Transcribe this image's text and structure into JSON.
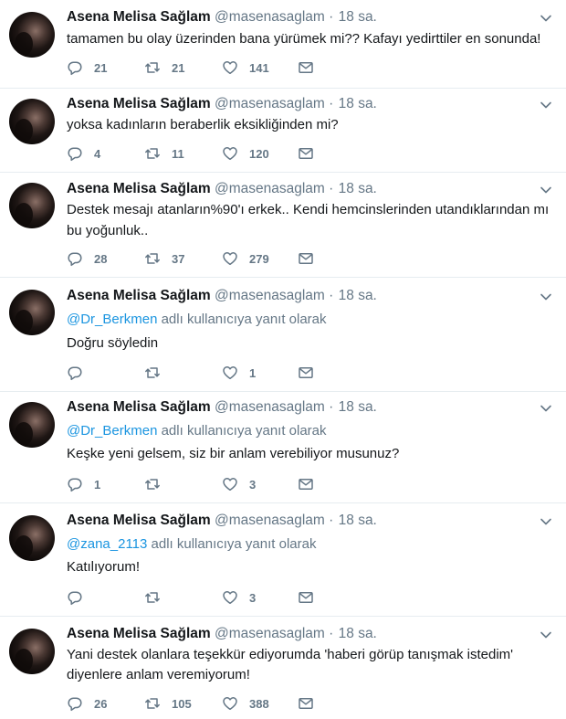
{
  "tweets": [
    {
      "name": "Asena Melisa Sağlam",
      "handle": "@masenasaglam",
      "dot": "·",
      "time": "18 sa.",
      "reply_to": null,
      "lines": [
        "tamamen bu olay üzerinden bana yürümek mi?? Kafayı yedirttiler en sonunda!"
      ],
      "replies": "21",
      "retweets": "21",
      "likes": "141"
    },
    {
      "name": "Asena Melisa Sağlam",
      "handle": "@masenasaglam",
      "dot": "·",
      "time": "18 sa.",
      "reply_to": null,
      "lines": [
        "yoksa kadınların beraberlik eksikliğinden mi?"
      ],
      "replies": "4",
      "retweets": "11",
      "likes": "120"
    },
    {
      "name": "Asena Melisa Sağlam",
      "handle": "@masenasaglam",
      "dot": "·",
      "time": "18 sa.",
      "reply_to": null,
      "lines": [
        "Destek mesajı atanların%90'ı erkek.. Kendi hemcinslerinden utandıklarından mı",
        "bu yoğunluk.."
      ],
      "replies": "28",
      "retweets": "37",
      "likes": "279"
    },
    {
      "name": "Asena Melisa Sağlam",
      "handle": "@masenasaglam",
      "dot": "·",
      "time": "18 sa.",
      "reply_to": {
        "mention": "@Dr_Berkmen",
        "suffix": " adlı kullanıcıya yanıt olarak"
      },
      "lines": [
        "Doğru söyledin"
      ],
      "replies": "",
      "retweets": "",
      "likes": "1"
    },
    {
      "name": "Asena Melisa Sağlam",
      "handle": "@masenasaglam",
      "dot": "·",
      "time": "18 sa.",
      "reply_to": {
        "mention": "@Dr_Berkmen",
        "suffix": " adlı kullanıcıya yanıt olarak"
      },
      "lines": [
        "Keşke yeni gelsem, siz bir anlam verebiliyor musunuz?"
      ],
      "replies": "1",
      "retweets": "",
      "likes": "3"
    },
    {
      "name": "Asena Melisa Sağlam",
      "handle": "@masenasaglam",
      "dot": "·",
      "time": "18 sa.",
      "reply_to": {
        "mention": "@zana_2113",
        "suffix": " adlı kullanıcıya yanıt olarak"
      },
      "lines": [
        "Katılıyorum!"
      ],
      "replies": "",
      "retweets": "",
      "likes": "3"
    },
    {
      "name": "Asena Melisa Sağlam",
      "handle": "@masenasaglam",
      "dot": "·",
      "time": "18 sa.",
      "reply_to": null,
      "lines": [
        "Yani destek olanlara teşekkür ediyorumda 'haberi görüp tanışmak istedim'",
        "diyenlere anlam veremiyorum!"
      ],
      "replies": "26",
      "retweets": "105",
      "likes": "388"
    }
  ],
  "icons": {
    "reply": "reply-icon",
    "retweet": "retweet-icon",
    "like": "heart-icon",
    "dm": "envelope-icon",
    "menu": "chevron-down-icon"
  },
  "colors": {
    "text": "#14171a",
    "muted": "#657786",
    "link": "#1b95e0",
    "divider": "#e6ecf0"
  }
}
